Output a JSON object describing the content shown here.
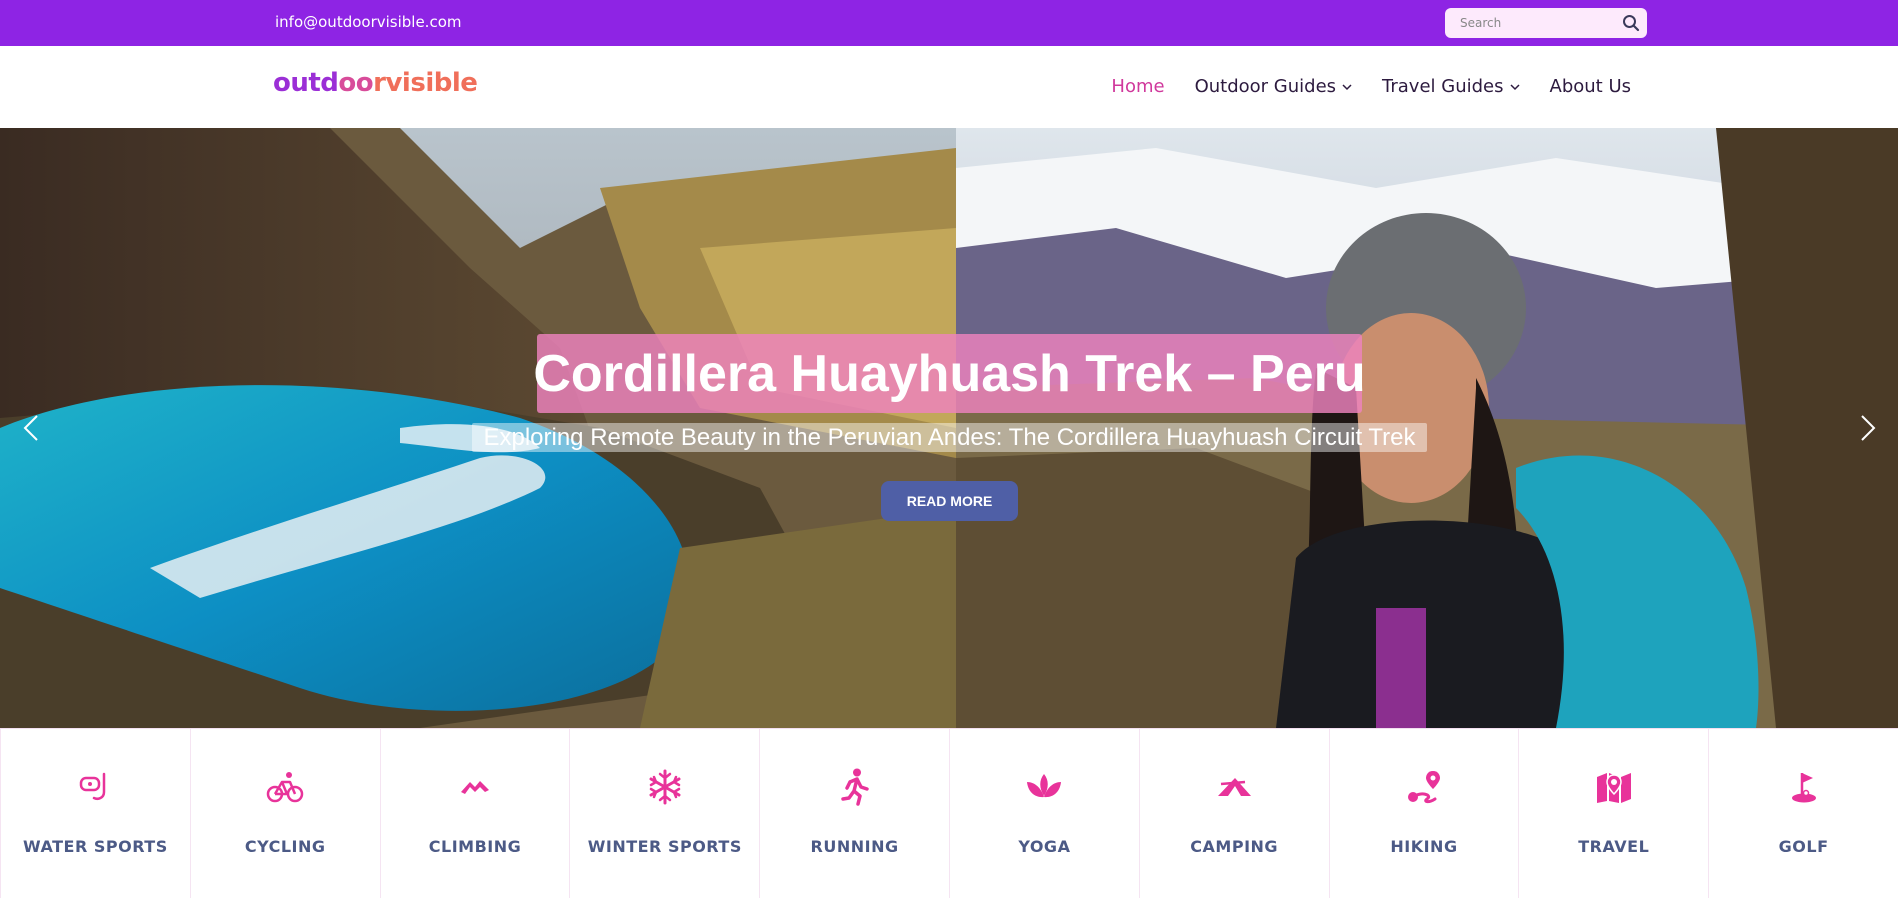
{
  "topbar": {
    "email": "info@outdoorvisible.com",
    "search_placeholder": "Search"
  },
  "logo": {
    "part1": "outd",
    "part2": "oo",
    "part3": "rvisible"
  },
  "nav": {
    "items": [
      {
        "label": "Home",
        "active": true,
        "dropdown": false
      },
      {
        "label": "Outdoor Guides",
        "active": false,
        "dropdown": true
      },
      {
        "label": "Travel Guides",
        "active": false,
        "dropdown": true
      },
      {
        "label": "About Us",
        "active": false,
        "dropdown": false
      }
    ]
  },
  "hero": {
    "title": "Cordillera Huayhuash Trek – Peru",
    "subtitle": "Exploring Remote Beauty in the Peruvian Andes: The Cordillera Huayhuash Circuit Trek",
    "button": "READ MORE"
  },
  "categories": [
    {
      "label": "WATER SPORTS",
      "icon": "snorkel-icon"
    },
    {
      "label": "CYCLING",
      "icon": "bicycle-icon"
    },
    {
      "label": "CLIMBING",
      "icon": "mountain-icon"
    },
    {
      "label": "WINTER SPORTS",
      "icon": "snowflake-icon"
    },
    {
      "label": "RUNNING",
      "icon": "running-person-icon"
    },
    {
      "label": "YOGA",
      "icon": "lotus-icon"
    },
    {
      "label": "CAMPING",
      "icon": "tent-icon"
    },
    {
      "label": "HIKING",
      "icon": "route-icon"
    },
    {
      "label": "TRAVEL",
      "icon": "map-pin-icon"
    },
    {
      "label": "GOLF",
      "icon": "golf-flag-icon"
    }
  ],
  "colors": {
    "topbar": "#8e24e4",
    "accent": "#d0399c",
    "icon": "#e8339a",
    "category_text": "#4c5a86",
    "button": "#4f5fa6"
  }
}
